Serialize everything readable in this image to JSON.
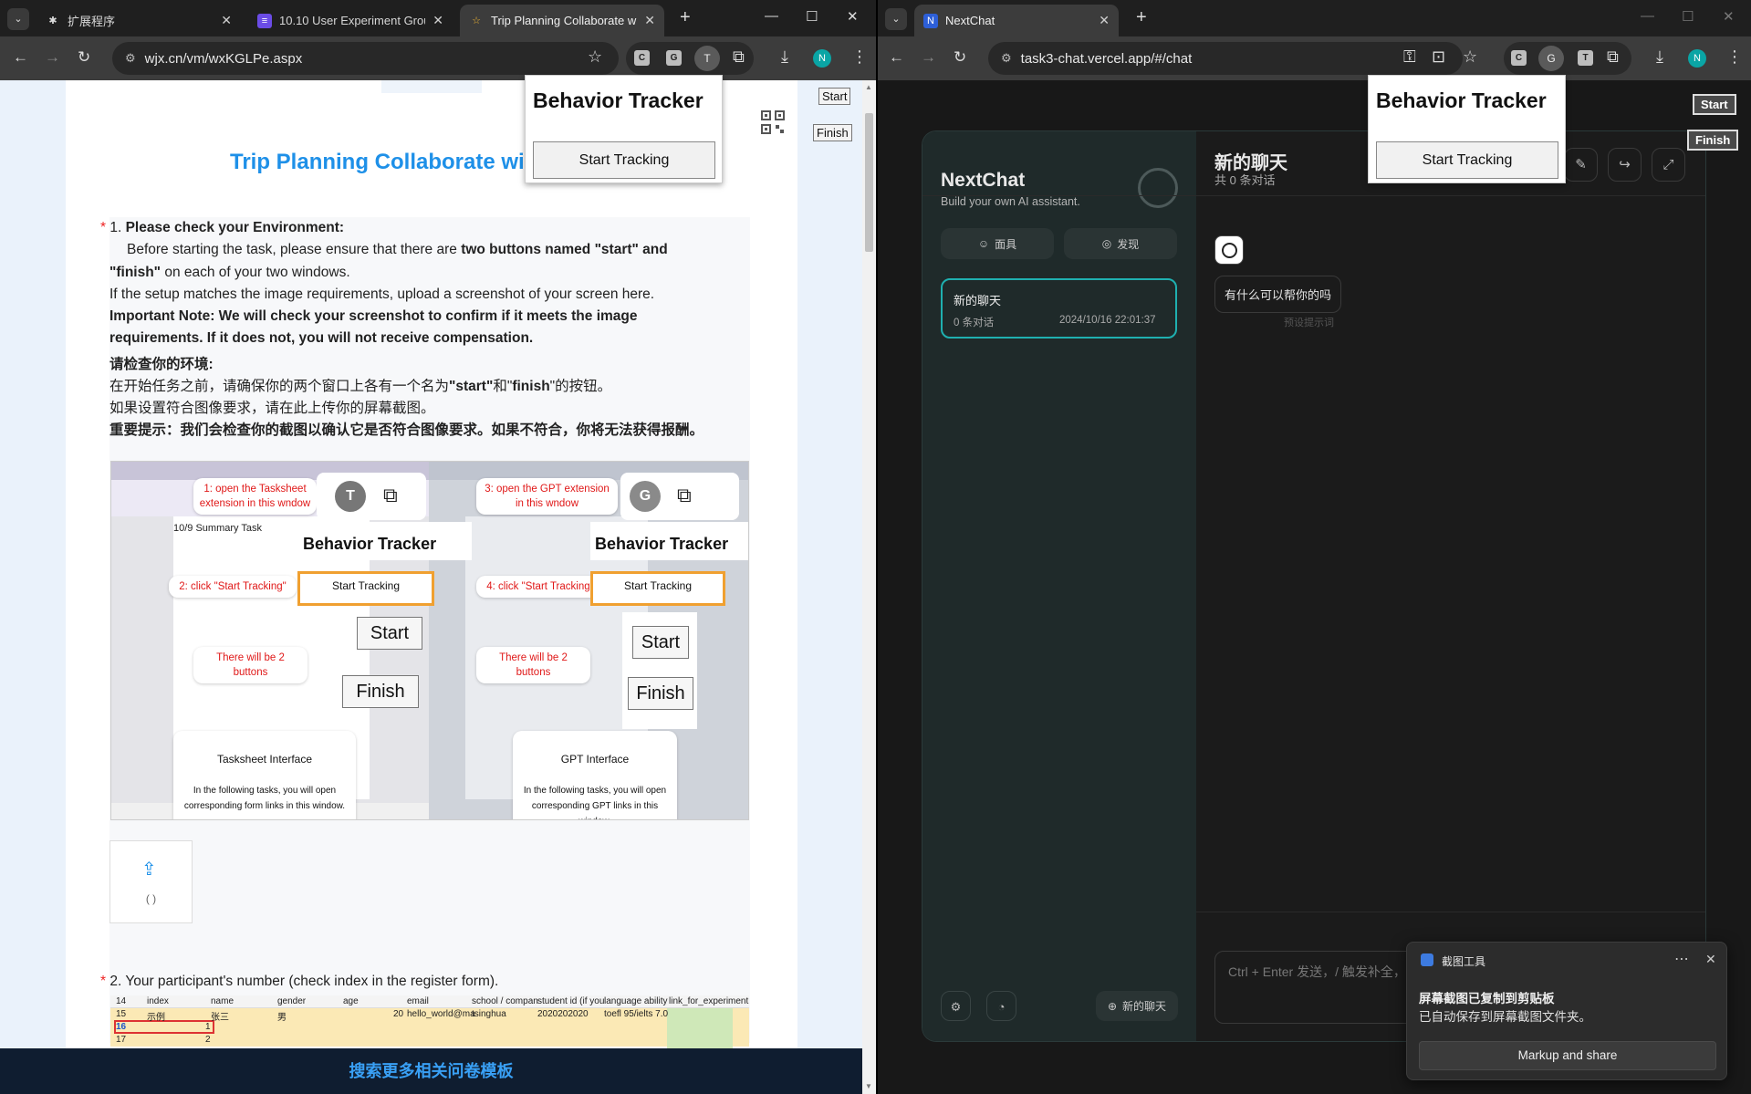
{
  "left_browser": {
    "tabs": [
      {
        "label": "扩展程序",
        "icon": "puzzle-icon"
      },
      {
        "label": "10.10 User Experiment Grou",
        "icon": "form-icon"
      },
      {
        "label": "Trip Planning Collaborate w",
        "icon": "star-icon"
      }
    ],
    "address": "wjx.cn/vm/wxKGLPe.aspx",
    "extensions": [
      "C",
      "G",
      "T"
    ],
    "profile_initial": "N"
  },
  "left_page": {
    "title": "Trip Planning Collaborate wi",
    "q1": {
      "number": "1.",
      "heading": "Please check your Environment:",
      "line2a": "Before starting the task, please ensure that there are ",
      "line2b": "two buttons named \"start\" and",
      "line3a": "\"finish\"",
      "line3b": " on each of your two windows.",
      "line4": "If the setup matches the image requirements, upload a screenshot of your screen here.",
      "line5": "Important Note: We will check your screenshot to confirm if it meets the image",
      "line6": "requirements. If it does not, you will not receive compensation.",
      "cn1": "请检查你的环境:",
      "cn2a": "在开始任务之前，请确保你的两个窗口上各有一个名为",
      "cn2b": "\"start\"",
      "cn2c": "和\"",
      "cn2d": "finish",
      "cn2e": "\"的按钮。",
      "cn3": "如果设置符合图像要求，请在此上传你的屏幕截图。",
      "cn4": "重要提示：我们会检查你的截图以确认它是否符合图像要求。如果不符合，你将无法获得报酬。"
    },
    "annotation": {
      "step1": "1: open the Tasksheet\nextension in this wndow",
      "step2": "2: click \"Start Tracking\"",
      "step3": "3: open the GPT extension\nin this wndow",
      "step4": "4: click \"Start Tracking\"",
      "buttons_note_left": "There will be 2 buttons",
      "buttons_note_right": "There will be 2 buttons",
      "bt_title": "Behavior Tracker",
      "bt_button": "Start Tracking",
      "start": "Start",
      "finish": "Finish",
      "left_heading": "10/9 Summary Task",
      "tasksheet_title": "Tasksheet Interface",
      "tasksheet_desc": "In the following tasks, you will open\ncorresponding form links in this window.",
      "gpt_title": "GPT Interface",
      "gpt_desc": "In the following tasks, you will open\ncorresponding GPT links in this window."
    },
    "upload_caption": "( )",
    "q2": {
      "number": "2.",
      "text": "Your participant's number (check index in the register form)."
    },
    "sheet": {
      "headers": [
        "index",
        "name",
        "gender",
        "age",
        "email",
        "school / compan",
        "student id (if you",
        "language ability",
        "link_for_experiment"
      ],
      "row_numbers": [
        "14",
        "15",
        "16",
        "17"
      ],
      "rows": [
        [
          "示例",
          "张三",
          "男",
          "20",
          "hello_world@ma",
          "tsinghua",
          "2020202020",
          "toefl 95/ielts 7.0",
          ""
        ],
        [
          "1",
          "",
          "",
          "",
          "",
          "",
          "",
          "",
          ""
        ],
        [
          "2",
          "",
          "",
          "",
          "",
          "",
          "",
          "",
          ""
        ]
      ]
    },
    "footer": "搜索更多相关问卷模板",
    "start_button": "Start",
    "finish_button": "Finish"
  },
  "tracker_left": {
    "title": "Behavior Tracker",
    "button": "Start Tracking"
  },
  "tracker_right": {
    "title": "Behavior Tracker",
    "button": "Start Tracking"
  },
  "right_browser": {
    "tabs": [
      {
        "label": "NextChat",
        "icon": "nextchat-icon"
      }
    ],
    "address": "task3-chat.vercel.app/#/chat",
    "extensions": [
      "C",
      "G",
      "T"
    ],
    "profile_initial": "N"
  },
  "nextchat": {
    "brand": "NextChat",
    "tagline": "Build your own AI assistant.",
    "mask_button": "面具",
    "discover_button": "发现",
    "session": {
      "title": "新的聊天",
      "count": "0 条对话",
      "time": "2024/10/16 22:01:37"
    },
    "chat_title": "新的聊天",
    "chat_subtitle": "共 0 条对话",
    "bot_message": "有什么可以帮你的吗",
    "preset_hint": "预设提示词",
    "input_placeholder": "Ctrl + Enter 发送，/ 触发补全，",
    "new_chat_button": "新的聊天"
  },
  "right_page_buttons": {
    "start": "Start",
    "finish": "Finish"
  },
  "snip_toast": {
    "app": "截图工具",
    "title": "屏幕截图已复制到剪贴板",
    "body": "已自动保存到屏幕截图文件夹。",
    "action": "Markup and share"
  },
  "colors": {
    "accent_blue": "#1e90e8",
    "nextchat_teal": "#1fb0b0",
    "annotation_red": "#e01818",
    "annotation_orange": "#f0a030"
  }
}
